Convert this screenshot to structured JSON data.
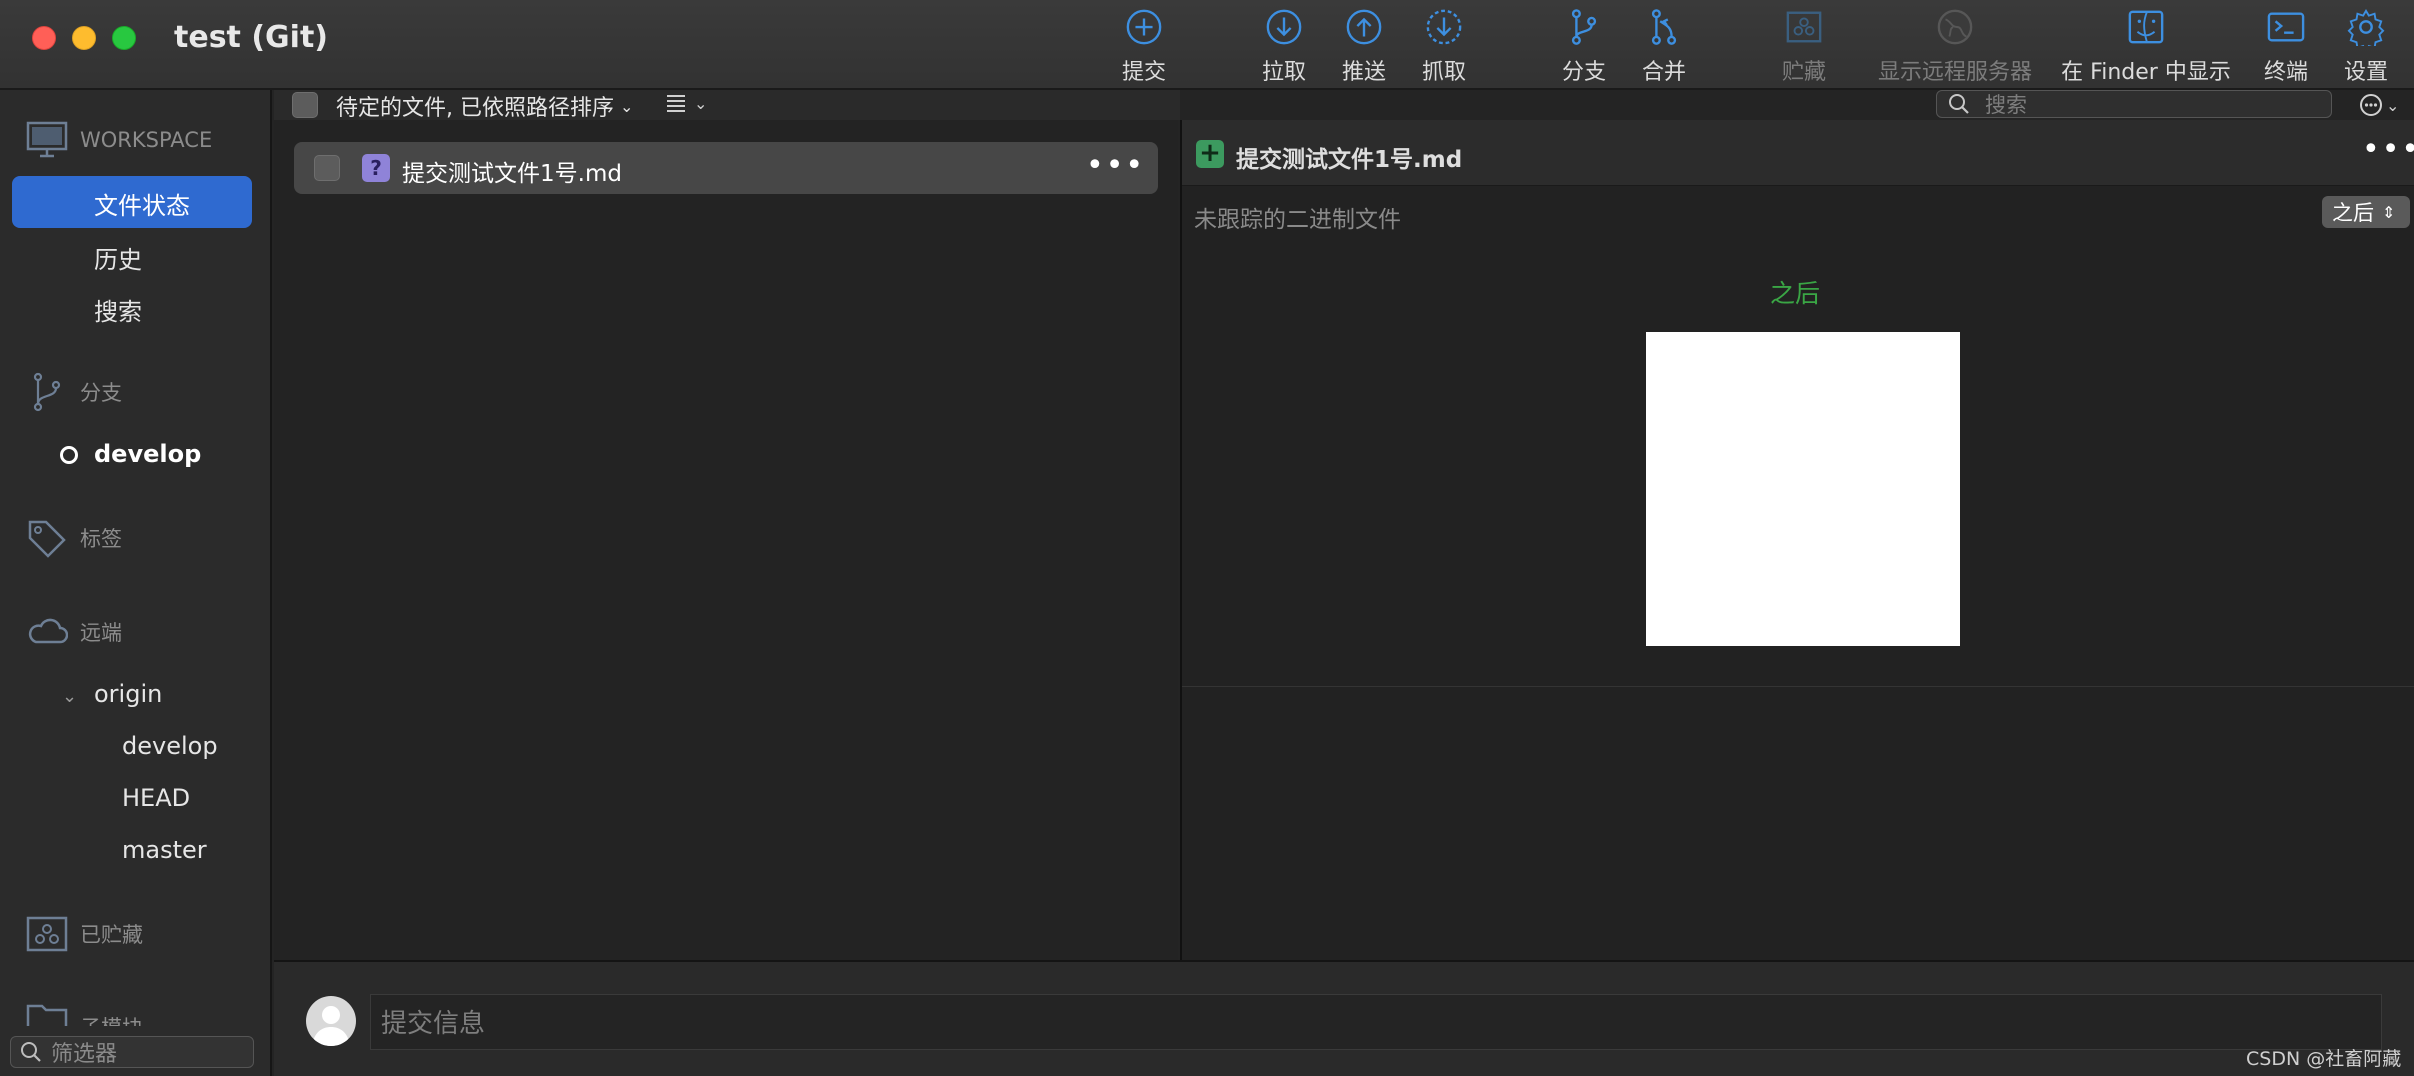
{
  "window": {
    "title": "test (Git)"
  },
  "toolbar": {
    "items": [
      {
        "label": "提交",
        "icon": "plus-circle-icon"
      },
      {
        "label": "拉取",
        "icon": "arrow-down-circle-icon"
      },
      {
        "label": "推送",
        "icon": "arrow-up-circle-icon"
      },
      {
        "label": "抓取",
        "icon": "arrow-down-dashed-circle-icon"
      },
      {
        "label": "分支",
        "icon": "branch-icon"
      },
      {
        "label": "合并",
        "icon": "merge-icon"
      },
      {
        "label": "贮藏",
        "icon": "stash-icon",
        "disabled": true
      },
      {
        "label": "显示远程服务器",
        "icon": "globe-icon",
        "disabled": true
      },
      {
        "label": "在 Finder 中显示",
        "icon": "finder-icon"
      },
      {
        "label": "终端",
        "icon": "terminal-icon"
      },
      {
        "label": "设置",
        "icon": "gear-icon"
      }
    ]
  },
  "sidebar": {
    "workspace": {
      "label": "WORKSPACE",
      "items": [
        "文件状态",
        "历史",
        "搜索"
      ]
    },
    "branches": {
      "label": "分支",
      "items": [
        "develop"
      ]
    },
    "tags": {
      "label": "标签"
    },
    "remotes": {
      "label": "远端",
      "origin": "origin",
      "items": [
        "develop",
        "HEAD",
        "master"
      ]
    },
    "stashes": {
      "label": "已贮藏"
    },
    "submodules": {
      "label": "子模块"
    },
    "filter_placeholder": "筛选器"
  },
  "filelist": {
    "sort_label": "待定的文件, 已依照路径排序",
    "files": [
      {
        "name": "提交测试文件1号.md",
        "status": "untracked"
      }
    ]
  },
  "search": {
    "placeholder": "搜索"
  },
  "diff": {
    "file_name": "提交测试文件1号.md",
    "subtitle": "未跟踪的二进制文件",
    "mode_select": "之后",
    "after_label": "之后"
  },
  "commit": {
    "placeholder": "提交信息"
  },
  "watermark": "CSDN @社畜阿藏",
  "colors": {
    "accent": "#2f6ad0",
    "added": "#3c9a5f",
    "after_green": "#3aa645",
    "toolbar_icon": "#3d8fe0"
  }
}
